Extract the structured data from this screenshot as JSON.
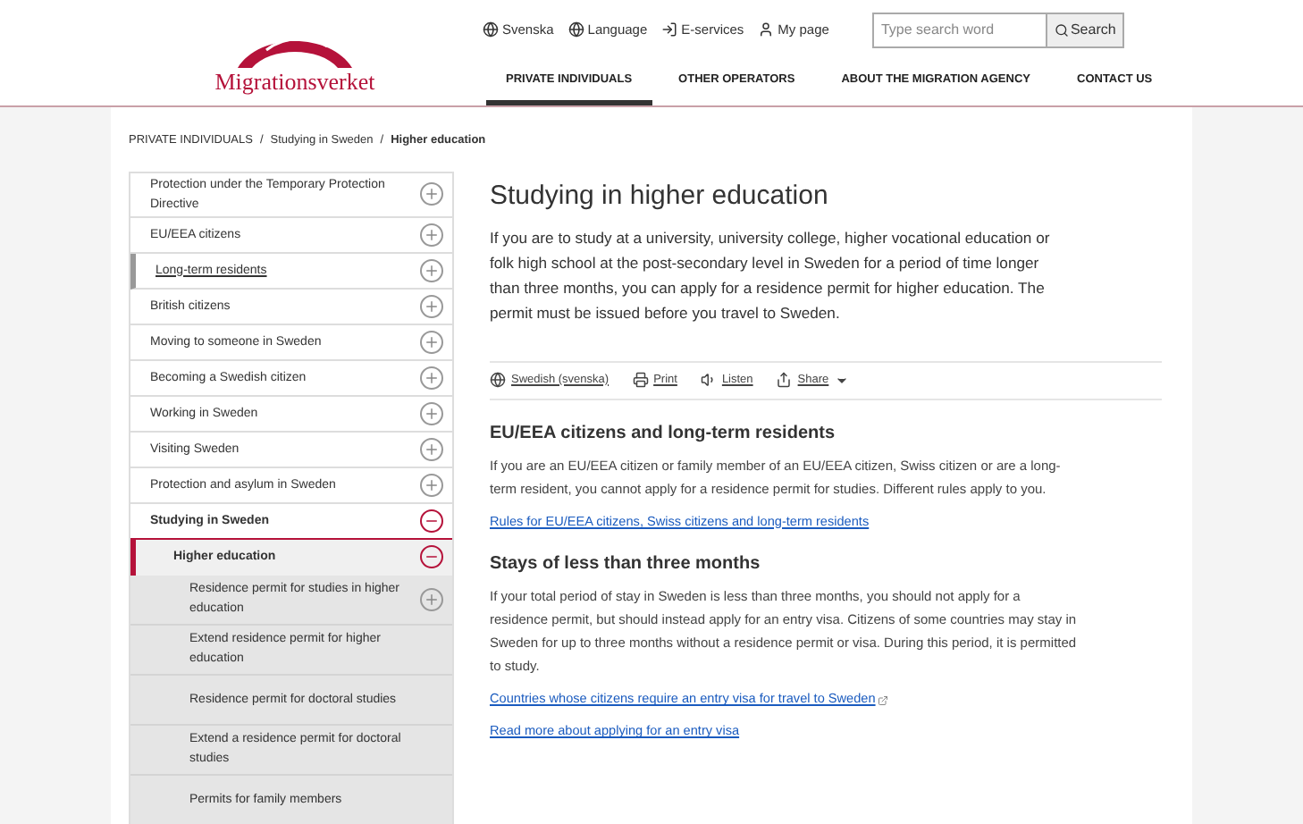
{
  "header": {
    "logo": "Migrationsverket",
    "utility_links": [
      {
        "kind": "globe",
        "label": "Svenska"
      },
      {
        "kind": "globe",
        "label": "Language"
      },
      {
        "kind": "login",
        "label": "E-services"
      },
      {
        "kind": "user",
        "label": "My page"
      }
    ],
    "search": {
      "placeholder": "Type search word",
      "button": "Search"
    },
    "nav": [
      {
        "label": "PRIVATE INDIVIDUALS",
        "selected": true
      },
      {
        "label": "OTHER OPERATORS",
        "selected": false
      },
      {
        "label": "ABOUT THE MIGRATION AGENCY",
        "selected": false
      },
      {
        "label": "CONTACT US",
        "selected": false
      }
    ]
  },
  "breadcrumb": [
    {
      "label": "PRIVATE INDIVIDUALS",
      "current": false,
      "separator": "/"
    },
    {
      "label": "Studying in Sweden",
      "current": false,
      "separator": "/"
    },
    {
      "label": "Higher education",
      "current": true
    }
  ],
  "sidebar": {
    "items": [
      {
        "label": "Protection under the Temporary Protection Directive",
        "expanded": false,
        "hovered": false
      },
      {
        "label": "EU/EEA citizens",
        "expanded": false,
        "hovered": false
      },
      {
        "label": "Long-term residents",
        "expanded": false,
        "hovered": true
      },
      {
        "label": "British citizens",
        "expanded": false,
        "hovered": false
      },
      {
        "label": "Moving to someone in Sweden",
        "expanded": false,
        "hovered": false
      },
      {
        "label": "Becoming a Swedish citizen",
        "expanded": false,
        "hovered": false
      },
      {
        "label": "Working in Sweden",
        "expanded": false,
        "hovered": false
      },
      {
        "label": "Visiting Sweden",
        "expanded": false,
        "hovered": false
      },
      {
        "label": "Protection and asylum in Sweden",
        "expanded": false,
        "hovered": false
      },
      {
        "label": "Studying in Sweden",
        "expanded": true,
        "hovered": false,
        "children": [
          {
            "label": "Higher education",
            "expanded": true,
            "selected": true,
            "children": [
              {
                "label": "Residence permit for studies in higher education",
                "kind": "expandable",
                "expanded": false
              },
              {
                "label": "Extend residence permit for higher education",
                "kind": "leaf"
              },
              {
                "label": "Residence permit for doctoral studies",
                "kind": "leaf"
              },
              {
                "label": "Extend a residence permit for doctoral studies",
                "kind": "leaf"
              },
              {
                "label": "Permits for family members",
                "kind": "leaf"
              }
            ]
          }
        ]
      }
    ]
  },
  "article": {
    "title": "Studying in higher education",
    "intro": "If you are to study at a university, university college, higher vocational education or folk high school at the post-secondary level in Sweden for a period of time longer than three months, you can apply for a residence permit for higher education. The permit must be issued before you travel to Sweden.",
    "tools": [
      {
        "kind": "globe",
        "label": "Swedish (svenska)"
      },
      {
        "kind": "print",
        "label": "Print"
      },
      {
        "kind": "listen",
        "label": "Listen"
      },
      {
        "kind": "share",
        "label": "Share"
      }
    ],
    "sections": [
      {
        "heading": "EU/EEA citizens and long-term residents",
        "text": "If you are an EU/EEA citizen or family member of an EU/EEA citizen, Swiss citizen or are a long-term resident, you cannot apply for a residence permit for studies. Different rules apply to you.",
        "links": [
          {
            "label": "Rules for EU/EEA citizens, Swiss citizens and long-term residents",
            "external": false
          }
        ]
      },
      {
        "heading": "Stays of less than three months",
        "text": "If your total period of stay in Sweden is less than three months, you should not apply for a residence permit, but should instead apply for an entry visa. Citizens of some countries may stay in Sweden for up to three months without a residence permit or visa. During this period, it is permitted to study.",
        "links": [
          {
            "label": "Countries whose citizens require an entry visa for travel to Sweden",
            "external": true
          },
          {
            "label": "Read more about applying for an entry visa",
            "external": false
          }
        ]
      }
    ]
  }
}
